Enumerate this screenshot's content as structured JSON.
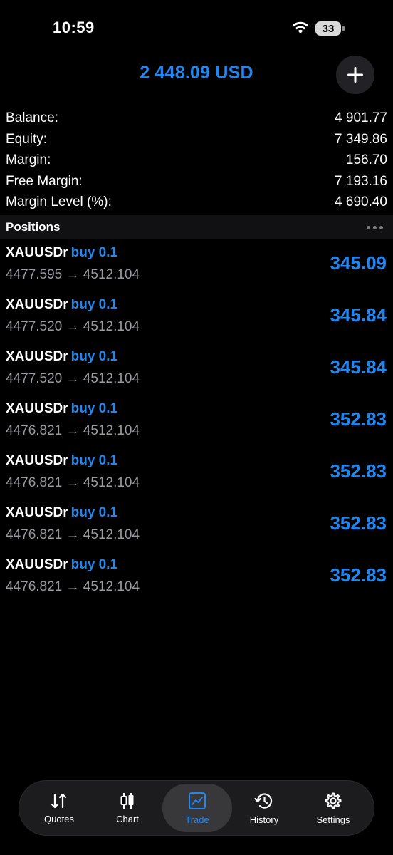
{
  "status_bar": {
    "time": "10:59",
    "battery": "33"
  },
  "header": {
    "amount": "2 448.09 USD"
  },
  "summary": [
    {
      "label": "Balance:",
      "value": "4 901.77"
    },
    {
      "label": "Equity:",
      "value": "7 349.86"
    },
    {
      "label": "Margin:",
      "value": "156.70"
    },
    {
      "label": "Free Margin:",
      "value": "7 193.16"
    },
    {
      "label": "Margin Level (%):",
      "value": "4 690.40"
    }
  ],
  "positions": {
    "title": "Positions",
    "items": [
      {
        "symbol": "XAUUSDr",
        "type": "buy 0.1",
        "prices": "4477.595 → 4512.104",
        "profit": "345.09"
      },
      {
        "symbol": "XAUUSDr",
        "type": "buy 0.1",
        "prices": "4477.520 → 4512.104",
        "profit": "345.84"
      },
      {
        "symbol": "XAUUSDr",
        "type": "buy 0.1",
        "prices": "4477.520 → 4512.104",
        "profit": "345.84"
      },
      {
        "symbol": "XAUUSDr",
        "type": "buy 0.1",
        "prices": "4476.821 → 4512.104",
        "profit": "352.83"
      },
      {
        "symbol": "XAUUSDr",
        "type": "buy 0.1",
        "prices": "4476.821 → 4512.104",
        "profit": "352.83"
      },
      {
        "symbol": "XAUUSDr",
        "type": "buy 0.1",
        "prices": "4476.821 → 4512.104",
        "profit": "352.83"
      },
      {
        "symbol": "XAUUSDr",
        "type": "buy 0.1",
        "prices": "4476.821 → 4512.104",
        "profit": "352.83"
      }
    ]
  },
  "tabbar": {
    "active": "Trade",
    "tabs": [
      {
        "label": "Quotes",
        "icon": "quotes-arrows-icon"
      },
      {
        "label": "Chart",
        "icon": "candlestick-icon"
      },
      {
        "label": "Trade",
        "icon": "trade-chart-icon"
      },
      {
        "label": "History",
        "icon": "history-clock-icon"
      },
      {
        "label": "Settings",
        "icon": "gear-icon"
      }
    ]
  },
  "colors": {
    "accent": "#1f86f2",
    "background": "#000000",
    "muted": "#9a9aa0"
  }
}
